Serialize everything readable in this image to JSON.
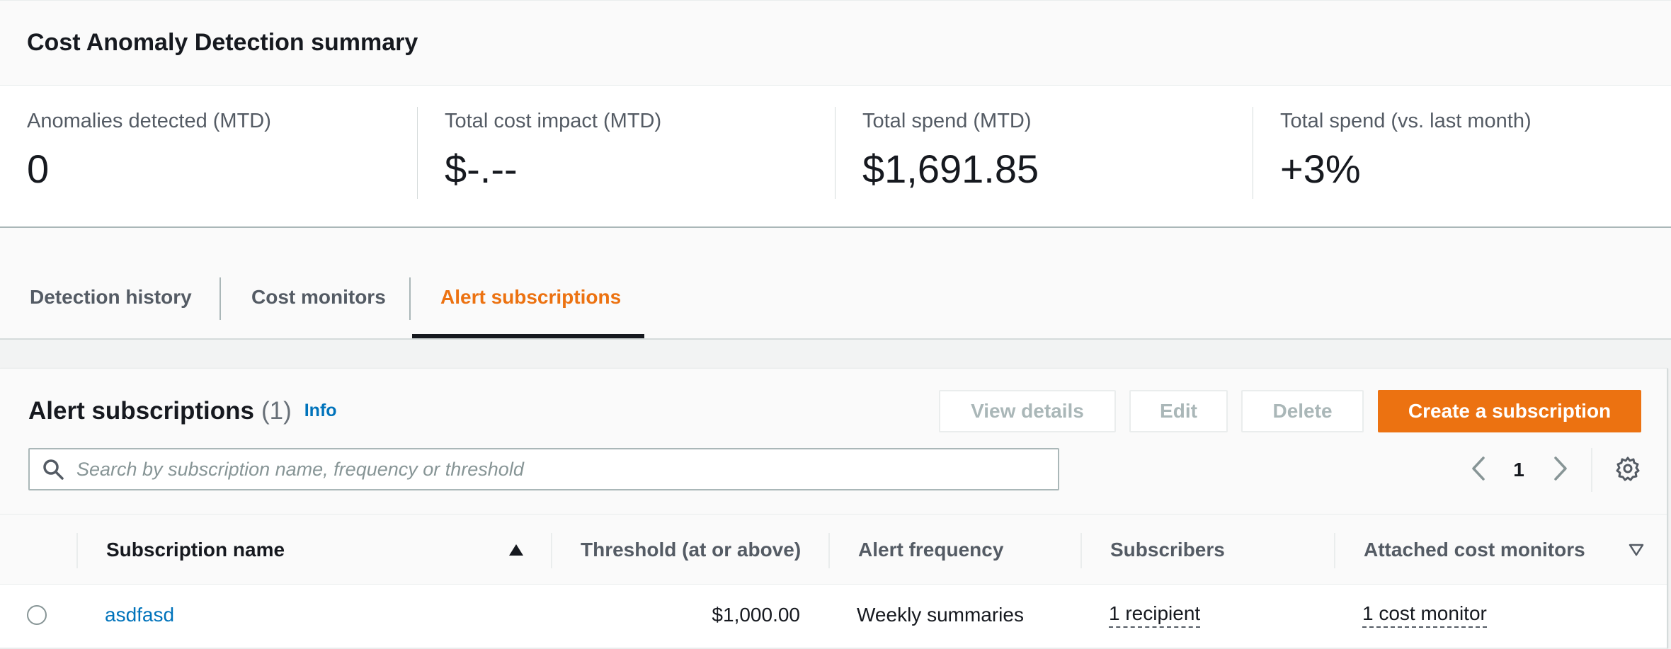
{
  "summary": {
    "title": "Cost Anomaly Detection summary",
    "metrics": [
      {
        "label": "Anomalies detected (MTD)",
        "value": "0"
      },
      {
        "label": "Total cost impact (MTD)",
        "value": "$-.--"
      },
      {
        "label": "Total spend (MTD)",
        "value": "$1,691.85"
      },
      {
        "label": "Total spend (vs. last month)",
        "value": "+3%"
      }
    ]
  },
  "tabs": [
    {
      "label": "Detection history",
      "active": false
    },
    {
      "label": "Cost monitors",
      "active": false
    },
    {
      "label": "Alert subscriptions",
      "active": true
    }
  ],
  "panel": {
    "title": "Alert subscriptions",
    "count": "(1)",
    "info": "Info",
    "buttons": {
      "view_details": "View details",
      "edit": "Edit",
      "delete": "Delete",
      "create": "Create a subscription"
    },
    "search": {
      "placeholder": "Search by subscription name, frequency or threshold",
      "value": ""
    },
    "pagination": {
      "current_page": "1"
    }
  },
  "table": {
    "columns": [
      "Subscription name",
      "Threshold (at or above)",
      "Alert frequency",
      "Subscribers",
      "Attached cost monitors"
    ],
    "sort": {
      "column": "Subscription name",
      "direction": "ascending"
    },
    "rows": [
      {
        "subscription_name": "asdfasd",
        "threshold": "$1,000.00",
        "alert_frequency": "Weekly summaries",
        "subscribers": "1 recipient",
        "attached_cost_monitors": "1 cost monitor"
      }
    ]
  },
  "colors": {
    "accent": "#ec7211",
    "link": "#0073bb",
    "text": "#16191f",
    "muted": "#545b64"
  },
  "icons": [
    "search-icon",
    "chevron-left-icon",
    "chevron-right-icon",
    "gear-icon",
    "sort-ascending-icon",
    "sort-descending-icon"
  ]
}
